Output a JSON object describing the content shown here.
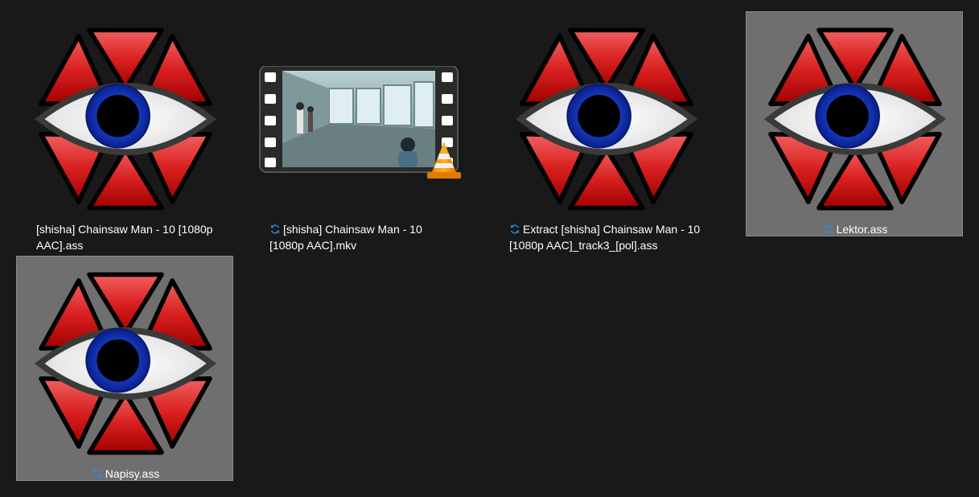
{
  "window": {
    "view": "Large icons"
  },
  "colors": {
    "background": "#191919",
    "selected_tile": "#6f6f6f",
    "sync_icon": "#2b8be6",
    "text": "#ffffff"
  },
  "files": [
    {
      "name": "[shisha] Chainsaw Man - 10 [1080p AAC].ass",
      "icon": "aegisub-eye-icon",
      "sync": false,
      "selected": false
    },
    {
      "name": "[shisha] Chainsaw Man - 10 [1080p AAC].mkv",
      "icon": "video-thumbnail-vlc-icon",
      "sync": true,
      "selected": false
    },
    {
      "name": "Extract [shisha] Chainsaw Man - 10 [1080p AAC]_track3_[pol].ass",
      "icon": "aegisub-eye-icon",
      "sync": true,
      "selected": false
    },
    {
      "name": "Lektor.ass",
      "icon": "aegisub-eye-icon",
      "sync": true,
      "selected": true
    },
    {
      "name": "Napisy.ass",
      "icon": "aegisub-eye-icon",
      "sync": true,
      "selected": true
    }
  ]
}
